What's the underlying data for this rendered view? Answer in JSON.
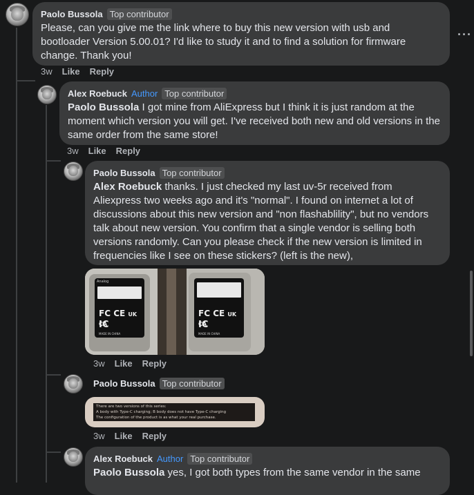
{
  "comments": [
    {
      "author": "Paolo Bussola",
      "badges": [
        "Top contributor"
      ],
      "mention": "",
      "text": "Please, can you give me the link where to buy this new version with usb and bootloader Version 5.00.01? I'd like to study it and to find a solution for firmware change. Thank you!",
      "time": "3w",
      "like": "Like",
      "reply": "Reply"
    },
    {
      "author": "Alex Roebuck",
      "author_badge": "Author",
      "badges": [
        "Top contributor"
      ],
      "mention": "Paolo Bussola",
      "text": " I got mine from AliExpress but I think it is just random at the moment which version you will get. I've received both new and old versions in the same order from the same store!",
      "time": "3w",
      "like": "Like",
      "reply": "Reply"
    },
    {
      "author": "Paolo Bussola",
      "badges": [
        "Top contributor"
      ],
      "mention": "Alex Roebuck",
      "text": " thanks. I just checked my last uv-5r received from Aliexpress two weeks ago and it's \"normal\". I found on internet a lot of discussions about this new version and \"non flashablility\", but no vendors talk about new version. You confirm that a single vendor is selling both versions randomly. Can you please check if the new version is limited in frequencies like I see on these stickers? (left is the new),",
      "time": "3w",
      "like": "Like",
      "reply": "Reply",
      "photo_labels": {
        "brand": "Analog",
        "made_in": "MADE IN CHINA",
        "fc": "FC",
        "ce": "CE",
        "ic": "IC",
        "ukca": "UK CA"
      }
    },
    {
      "author": "Paolo Bussola",
      "badges": [
        "Top contributor"
      ],
      "image_text": [
        "There are two versions of this series:",
        "A body with Type-C charging; B body does not have Type-C charging",
        "The configuration of the product is as what your real purchase."
      ],
      "time": "3w",
      "like": "Like",
      "reply": "Reply"
    },
    {
      "author": "Alex Roebuck",
      "author_badge": "Author",
      "badges": [
        "Top contributor"
      ],
      "mention": "Paolo Bussola",
      "text": " yes, I got both types from the same vendor in the same"
    }
  ],
  "more_icon": "more-horizontal-icon",
  "more_label": "···"
}
